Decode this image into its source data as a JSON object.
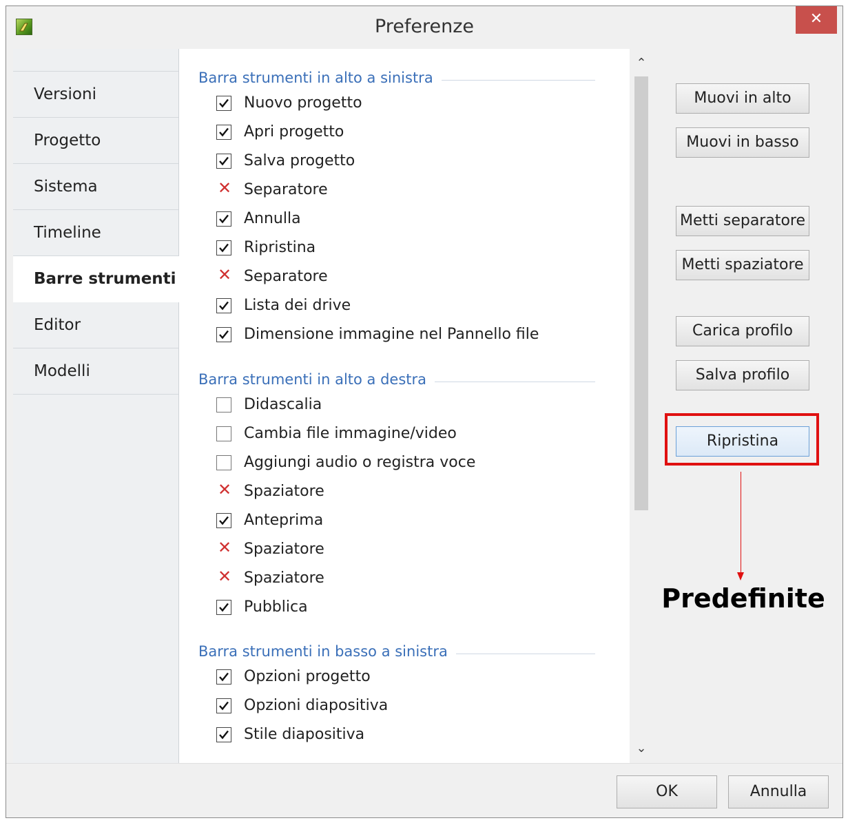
{
  "window": {
    "title": "Preferenze",
    "close_label": "✕"
  },
  "sidebar": {
    "items": [
      {
        "label": "Versioni"
      },
      {
        "label": "Progetto"
      },
      {
        "label": "Sistema"
      },
      {
        "label": "Timeline"
      },
      {
        "label": "Barre strumenti",
        "active": true
      },
      {
        "label": "Editor"
      },
      {
        "label": "Modelli"
      }
    ]
  },
  "groups": [
    {
      "header": "Barra strumenti in alto a sinistra",
      "items": [
        {
          "label": "Nuovo progetto",
          "state": "checked"
        },
        {
          "label": "Apri progetto",
          "state": "checked"
        },
        {
          "label": "Salva progetto",
          "state": "checked"
        },
        {
          "label": "Separatore",
          "state": "x"
        },
        {
          "label": "Annulla",
          "state": "checked"
        },
        {
          "label": "Ripristina",
          "state": "checked"
        },
        {
          "label": "Separatore",
          "state": "x"
        },
        {
          "label": "Lista dei drive",
          "state": "checked"
        },
        {
          "label": "Dimensione immagine nel Pannello file",
          "state": "checked"
        }
      ]
    },
    {
      "header": "Barra strumenti in alto a destra",
      "items": [
        {
          "label": "Didascalia",
          "state": "unchecked"
        },
        {
          "label": "Cambia file immagine/video",
          "state": "unchecked"
        },
        {
          "label": "Aggiungi audio o registra voce",
          "state": "unchecked"
        },
        {
          "label": "Spaziatore",
          "state": "x"
        },
        {
          "label": "Anteprima",
          "state": "checked"
        },
        {
          "label": "Spaziatore",
          "state": "x"
        },
        {
          "label": "Spaziatore",
          "state": "x"
        },
        {
          "label": "Pubblica",
          "state": "checked"
        }
      ]
    },
    {
      "header": "Barra strumenti in basso a sinistra",
      "items": [
        {
          "label": "Opzioni progetto",
          "state": "checked"
        },
        {
          "label": "Opzioni diapositiva",
          "state": "checked"
        },
        {
          "label": "Stile diapositiva",
          "state": "checked"
        }
      ]
    }
  ],
  "buttons": {
    "move_up": "Muovi in alto",
    "move_down": "Muovi in basso",
    "add_separator": "Metti separatore",
    "add_spacer": "Metti spaziatore",
    "load_profile": "Carica profilo",
    "save_profile": "Salva profilo",
    "reset": "Ripristina"
  },
  "annotation": {
    "text": "Predefinite",
    "color": "#e01010"
  },
  "footer": {
    "ok": "OK",
    "cancel": "Annulla"
  },
  "icons": {
    "checked": "checkbox-checked-icon",
    "unchecked": "checkbox-empty-icon",
    "x": "red-x-icon"
  }
}
